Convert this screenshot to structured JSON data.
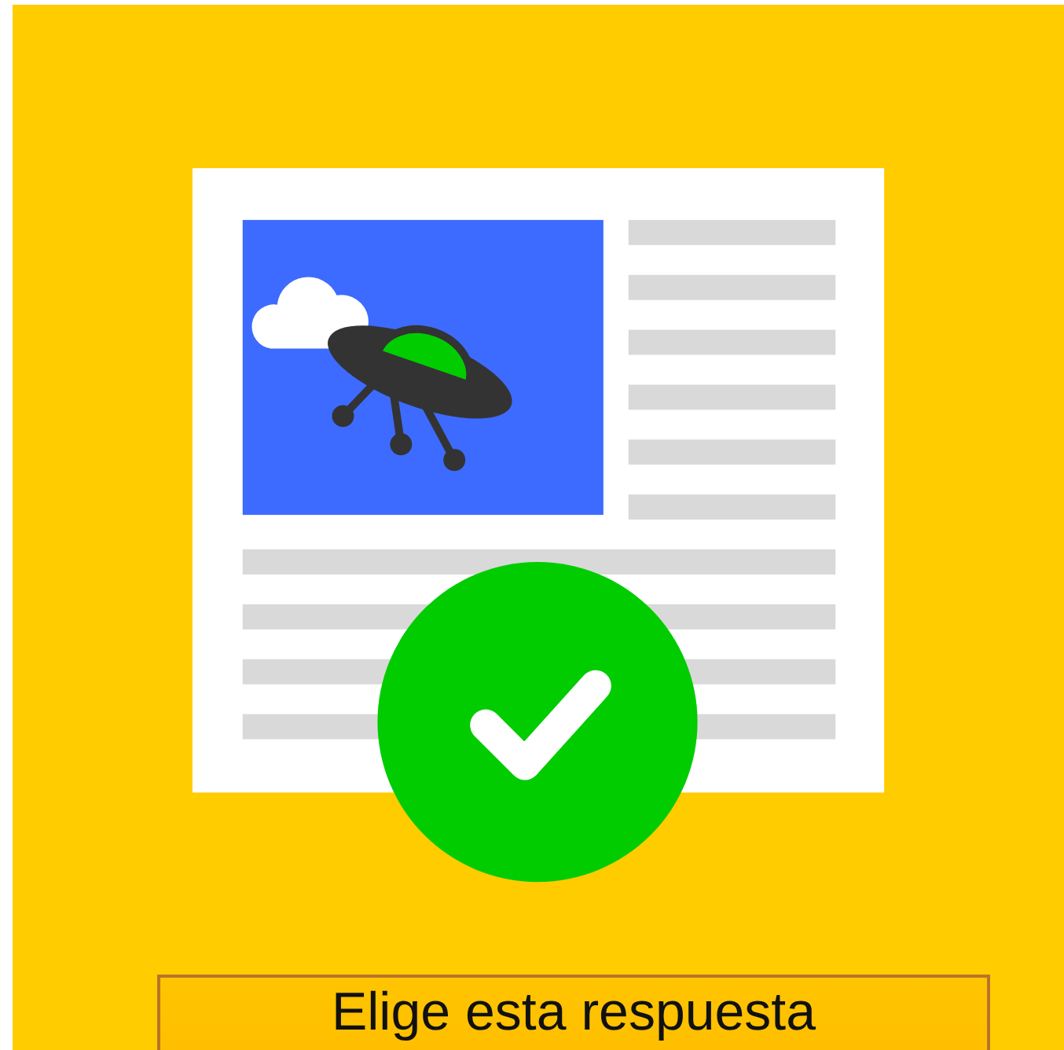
{
  "answer_button": {
    "label": "Elige esta respuesta"
  }
}
